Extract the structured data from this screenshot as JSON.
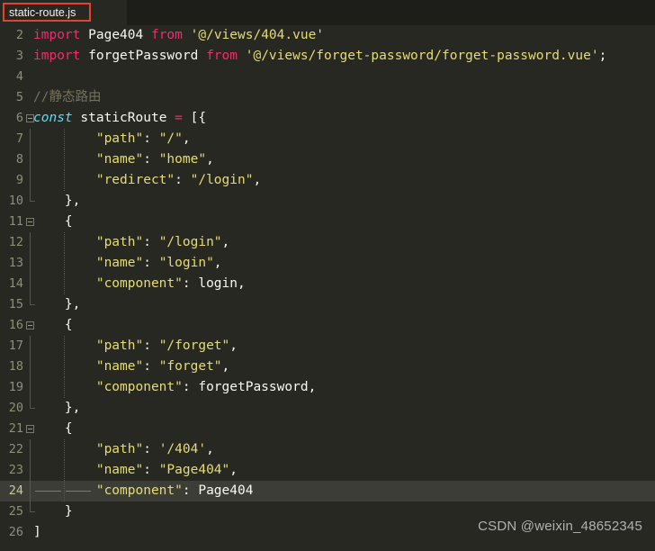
{
  "tabbar": {
    "active_tab_label": "static-route.js",
    "highlight_color": "#e8402a"
  },
  "editor": {
    "theme": "Monokai",
    "background": "#272822",
    "active_line_background": "#3d3d38",
    "active_line_number": 24,
    "line_number_color": "#8f8f77",
    "colors": {
      "keyword": "#f92672",
      "storage": "#66d9ef",
      "string": "#e6db74",
      "comment": "#75715e",
      "text": "#f8f8f2"
    },
    "lines": [
      {
        "num": "2",
        "segments": [
          {
            "t": "import",
            "c": "kw"
          },
          {
            "t": " ",
            "c": "plain"
          },
          {
            "t": "Page404",
            "c": "plain"
          },
          {
            "t": " ",
            "c": "plain"
          },
          {
            "t": "from",
            "c": "kw"
          },
          {
            "t": " ",
            "c": "plain"
          },
          {
            "t": "'@/views/404.vue'",
            "c": "str"
          }
        ]
      },
      {
        "num": "3",
        "segments": [
          {
            "t": "import",
            "c": "kw"
          },
          {
            "t": " ",
            "c": "plain"
          },
          {
            "t": "forgetPassword",
            "c": "plain"
          },
          {
            "t": " ",
            "c": "plain"
          },
          {
            "t": "from",
            "c": "kw"
          },
          {
            "t": " ",
            "c": "plain"
          },
          {
            "t": "'@/views/forget-password/forget-password.vue'",
            "c": "str"
          },
          {
            "t": ";",
            "c": "punct"
          }
        ]
      },
      {
        "num": "4",
        "segments": []
      },
      {
        "num": "5",
        "segments": [
          {
            "t": "//静态路由",
            "c": "comment"
          }
        ]
      },
      {
        "num": "6",
        "segments": [
          {
            "t": "const",
            "c": "kw-it"
          },
          {
            "t": " ",
            "c": "plain"
          },
          {
            "t": "staticRoute",
            "c": "plain"
          },
          {
            "t": " ",
            "c": "plain"
          },
          {
            "t": "=",
            "c": "kw"
          },
          {
            "t": " ",
            "c": "plain"
          },
          {
            "t": "[{",
            "c": "punct"
          }
        ]
      },
      {
        "num": "7",
        "segments": [
          {
            "t": "        \"path\"",
            "c": "key"
          },
          {
            "t": ": ",
            "c": "punct"
          },
          {
            "t": "\"/\"",
            "c": "str"
          },
          {
            "t": ",",
            "c": "punct"
          }
        ]
      },
      {
        "num": "8",
        "segments": [
          {
            "t": "        \"name\"",
            "c": "key"
          },
          {
            "t": ": ",
            "c": "punct"
          },
          {
            "t": "\"home\"",
            "c": "str"
          },
          {
            "t": ",",
            "c": "punct"
          }
        ]
      },
      {
        "num": "9",
        "segments": [
          {
            "t": "        \"redirect\"",
            "c": "key"
          },
          {
            "t": ": ",
            "c": "punct"
          },
          {
            "t": "\"/login\"",
            "c": "str"
          },
          {
            "t": ",",
            "c": "punct"
          }
        ]
      },
      {
        "num": "10",
        "segments": [
          {
            "t": "    },",
            "c": "punct"
          }
        ]
      },
      {
        "num": "11",
        "segments": [
          {
            "t": "    {",
            "c": "punct"
          }
        ]
      },
      {
        "num": "12",
        "segments": [
          {
            "t": "        \"path\"",
            "c": "key"
          },
          {
            "t": ": ",
            "c": "punct"
          },
          {
            "t": "\"/login\"",
            "c": "str"
          },
          {
            "t": ",",
            "c": "punct"
          }
        ]
      },
      {
        "num": "13",
        "segments": [
          {
            "t": "        \"name\"",
            "c": "key"
          },
          {
            "t": ": ",
            "c": "punct"
          },
          {
            "t": "\"login\"",
            "c": "str"
          },
          {
            "t": ",",
            "c": "punct"
          }
        ]
      },
      {
        "num": "14",
        "segments": [
          {
            "t": "        \"component\"",
            "c": "key"
          },
          {
            "t": ": ",
            "c": "punct"
          },
          {
            "t": "login",
            "c": "plain"
          },
          {
            "t": ",",
            "c": "punct"
          }
        ]
      },
      {
        "num": "15",
        "segments": [
          {
            "t": "    },",
            "c": "punct"
          }
        ]
      },
      {
        "num": "16",
        "segments": [
          {
            "t": "    {",
            "c": "punct"
          }
        ]
      },
      {
        "num": "17",
        "segments": [
          {
            "t": "        \"path\"",
            "c": "key"
          },
          {
            "t": ": ",
            "c": "punct"
          },
          {
            "t": "\"/forget\"",
            "c": "str"
          },
          {
            "t": ",",
            "c": "punct"
          }
        ]
      },
      {
        "num": "18",
        "segments": [
          {
            "t": "        \"name\"",
            "c": "key"
          },
          {
            "t": ": ",
            "c": "punct"
          },
          {
            "t": "\"forget\"",
            "c": "str"
          },
          {
            "t": ",",
            "c": "punct"
          }
        ]
      },
      {
        "num": "19",
        "segments": [
          {
            "t": "        \"component\"",
            "c": "key"
          },
          {
            "t": ": ",
            "c": "punct"
          },
          {
            "t": "forgetPassword",
            "c": "plain"
          },
          {
            "t": ",",
            "c": "punct"
          }
        ]
      },
      {
        "num": "20",
        "segments": [
          {
            "t": "    },",
            "c": "punct"
          }
        ]
      },
      {
        "num": "21",
        "segments": [
          {
            "t": "    {",
            "c": "punct"
          }
        ]
      },
      {
        "num": "22",
        "segments": [
          {
            "t": "        \"path\"",
            "c": "key"
          },
          {
            "t": ": ",
            "c": "punct"
          },
          {
            "t": "'/404'",
            "c": "str"
          },
          {
            "t": ",",
            "c": "punct"
          }
        ]
      },
      {
        "num": "23",
        "segments": [
          {
            "t": "        \"name\"",
            "c": "key"
          },
          {
            "t": ": ",
            "c": "punct"
          },
          {
            "t": "\"Page404\"",
            "c": "str"
          },
          {
            "t": ",",
            "c": "punct"
          }
        ]
      },
      {
        "num": "24",
        "segments": [
          {
            "t": "        \"component\"",
            "c": "key"
          },
          {
            "t": ": ",
            "c": "punct"
          },
          {
            "t": "Page404",
            "c": "plain"
          }
        ]
      },
      {
        "num": "25",
        "segments": [
          {
            "t": "    }",
            "c": "punct"
          }
        ]
      },
      {
        "num": "26",
        "segments": [
          {
            "t": "]",
            "c": "punct"
          }
        ]
      }
    ],
    "fold_open_lines": [
      "6",
      "11",
      "16",
      "21"
    ],
    "fold_end_lines": [
      "10",
      "15",
      "20",
      "25"
    ]
  },
  "watermark": {
    "text": "CSDN @weixin_48652345"
  }
}
